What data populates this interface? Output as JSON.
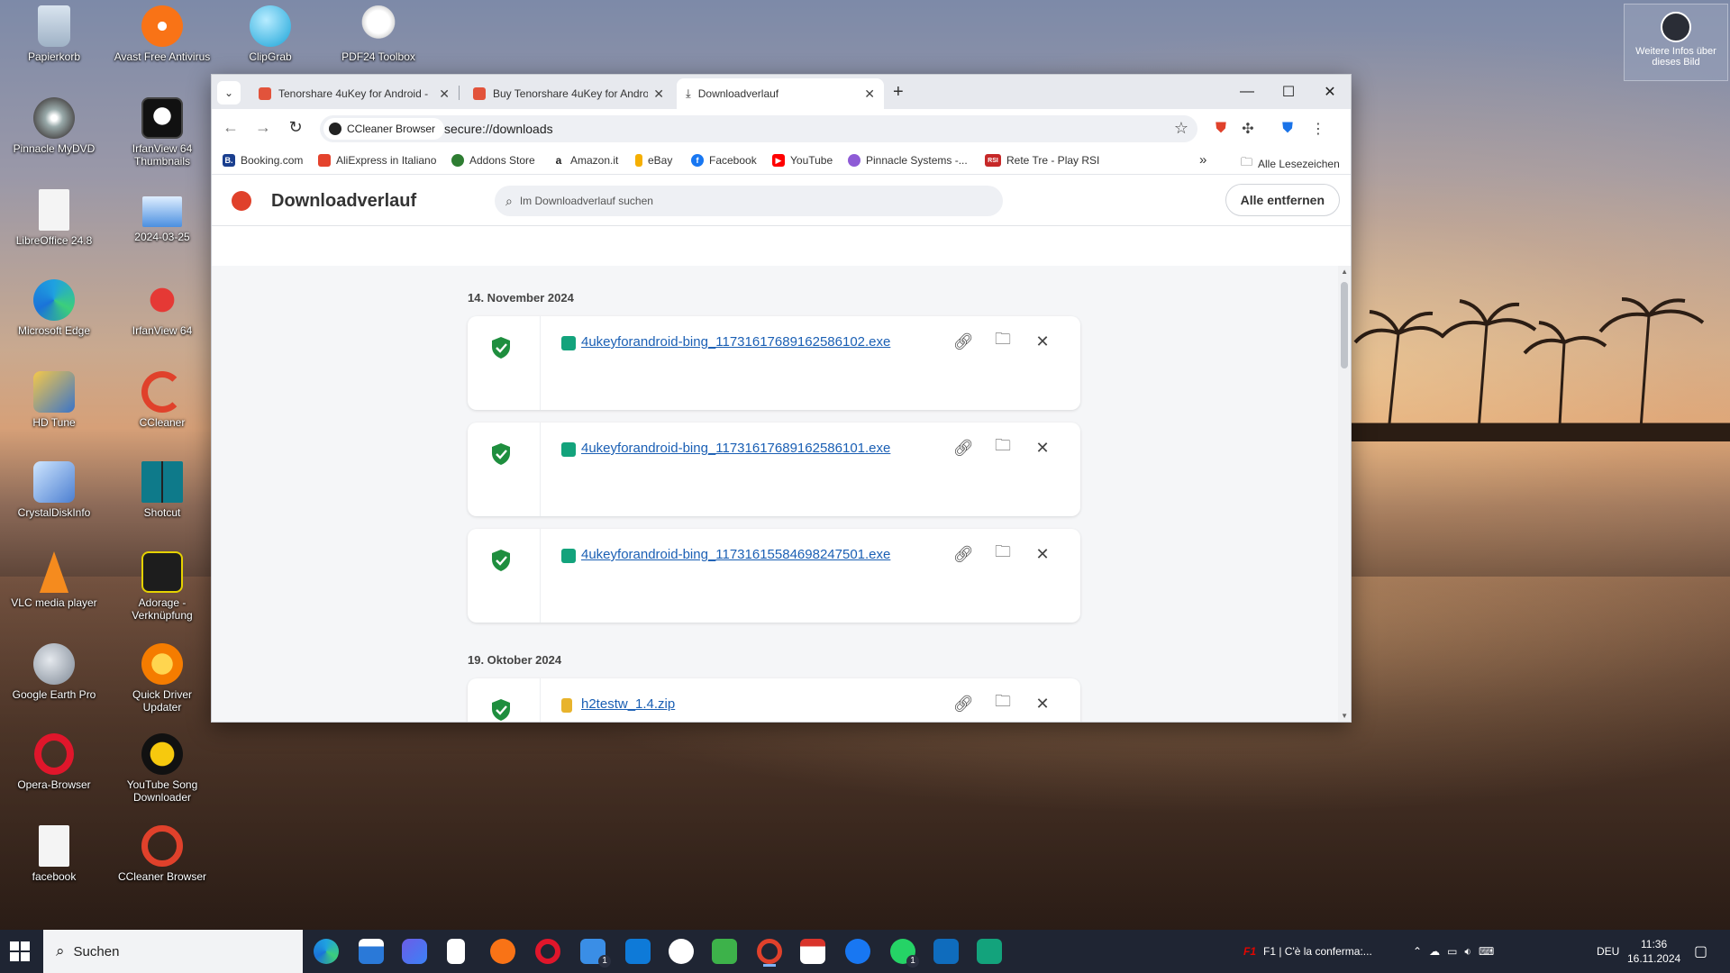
{
  "desktop": {
    "icons": [
      {
        "label": "Papierkorb"
      },
      {
        "label": "Avast Free Antivirus"
      },
      {
        "label": "ClipGrab"
      },
      {
        "label": "PDF24 Toolbox"
      },
      {
        "label": "Pinnacle MyDVD"
      },
      {
        "label": "IrfanView 64 Thumbnails"
      },
      {
        "label": "LibreOffice 24.8"
      },
      {
        "label": "2024-03-25"
      },
      {
        "label": "Microsoft Edge"
      },
      {
        "label": "IrfanView 64"
      },
      {
        "label": "HD Tune"
      },
      {
        "label": "CCleaner"
      },
      {
        "label": "CrystalDiskInfo"
      },
      {
        "label": "Shotcut"
      },
      {
        "label": "VLC media player"
      },
      {
        "label": "Adorage - Verknüpfung"
      },
      {
        "label": "Google Earth Pro"
      },
      {
        "label": "Quick Driver Updater"
      },
      {
        "label": "Opera-Browser"
      },
      {
        "label": "YouTube Song Downloader"
      },
      {
        "label": "facebook"
      },
      {
        "label": "CCleaner Browser"
      }
    ],
    "info_badge": "Weitere Infos über dieses Bild"
  },
  "browser": {
    "tabs": [
      {
        "title": "Tenorshare 4uKey for Android -",
        "favicon_color": "#e2533b"
      },
      {
        "title": "Buy Tenorshare 4uKey for Andro",
        "favicon_color": "#e2533b"
      },
      {
        "title": "Downloadverlauf",
        "active": true
      }
    ],
    "omnibox": {
      "chip_label": "CCleaner Browser",
      "url": "secure://downloads"
    },
    "bookmarks": [
      {
        "label": "Booking.com",
        "color": "#1a3f8f",
        "glyph": "B."
      },
      {
        "label": "AliExpress in Italiano",
        "color": "#e4432d",
        "glyph": ""
      },
      {
        "label": "Addons Store",
        "color": "#2e7d32",
        "glyph": ""
      },
      {
        "label": "Amazon.it",
        "color": "#222222",
        "glyph": "a"
      },
      {
        "label": "eBay",
        "color": "#f5af02",
        "glyph": ""
      },
      {
        "label": "Facebook",
        "color": "#1877f2",
        "glyph": "f"
      },
      {
        "label": "YouTube",
        "color": "#ff0000",
        "glyph": "▶"
      },
      {
        "label": "Pinnacle Systems -...",
        "color": "#8e5bd6",
        "glyph": ""
      },
      {
        "label": "Rete Tre - Play RSI",
        "color": "#c62828",
        "glyph": "RSI"
      }
    ],
    "bookmarks_overflow": "»",
    "all_bookmarks": "Alle Lesezeichen"
  },
  "downloads_page": {
    "title": "Downloadverlauf",
    "search_placeholder": "Im Downloadverlauf suchen",
    "remove_all": "Alle entfernen",
    "groups": [
      {
        "date": "14. November 2024",
        "items": [
          {
            "filename": "4ukeyforandroid-bing_11731617689162586102.exe",
            "icon_color": "#13a37c"
          },
          {
            "filename": "4ukeyforandroid-bing_11731617689162586101.exe",
            "icon_color": "#13a37c"
          },
          {
            "filename": "4ukeyforandroid-bing_11731615584698247501.exe",
            "icon_color": "#13a37c"
          }
        ]
      },
      {
        "date": "19. Oktober 2024",
        "items": [
          {
            "filename": "h2testw_1.4.zip",
            "icon_color": "#e8b32c"
          }
        ]
      }
    ]
  },
  "taskbar": {
    "search_label": "Suchen",
    "notification_text": "F1 | C'è la conferma:...",
    "language": "DEU",
    "time": "11:36",
    "date": "16.11.2024",
    "badges": {
      "mail": "1",
      "whatsapp": "1"
    }
  },
  "colors": {
    "accent_link": "#1a5fb4",
    "shield_green": "#1e8e3e",
    "ccleaner_red": "#e0412b"
  }
}
